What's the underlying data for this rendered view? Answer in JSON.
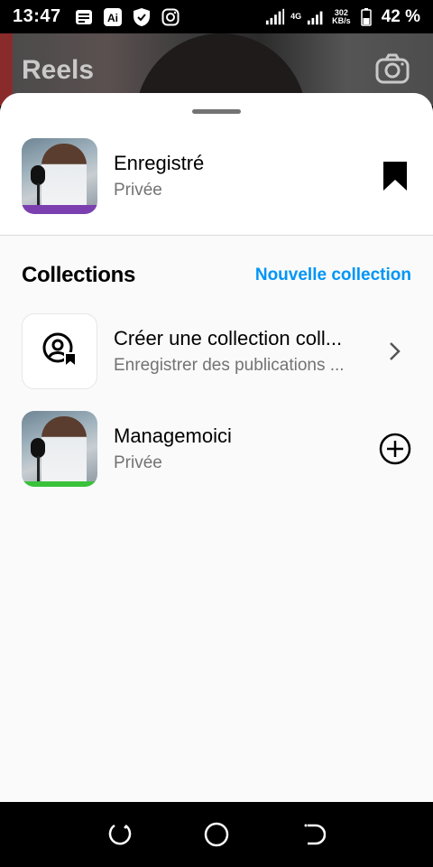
{
  "status_bar": {
    "time": "13:47",
    "network_type": "4G",
    "speed_value": "302",
    "speed_unit": "KB/s",
    "battery": "42 %"
  },
  "background": {
    "title": "Reels"
  },
  "saved": {
    "title": "Enregistré",
    "privacy": "Privée"
  },
  "collections": {
    "heading": "Collections",
    "new_collection_label": "Nouvelle collection",
    "items": [
      {
        "title": "Créer une collection coll...",
        "subtitle": "Enregistrer des publications ..."
      },
      {
        "title": "Managemoici",
        "subtitle": "Privée"
      }
    ]
  },
  "colors": {
    "accent": "#0095f6",
    "secondary_text": "#737373",
    "sheet_background": "#fafafa"
  },
  "icons": {
    "status_left": [
      "notes-icon",
      "ai-icon",
      "shield-icon",
      "instagram-icon"
    ],
    "status_right": [
      "signal-icon",
      "signal-icon",
      "battery-icon"
    ],
    "camera": "camera-icon",
    "bookmark": "bookmark-icon",
    "create_collection": "collaborative-collection-icon",
    "chevron": "chevron-right-icon",
    "add": "plus-circle-icon",
    "nav": [
      "recent-apps-icon",
      "home-icon",
      "back-icon"
    ]
  }
}
